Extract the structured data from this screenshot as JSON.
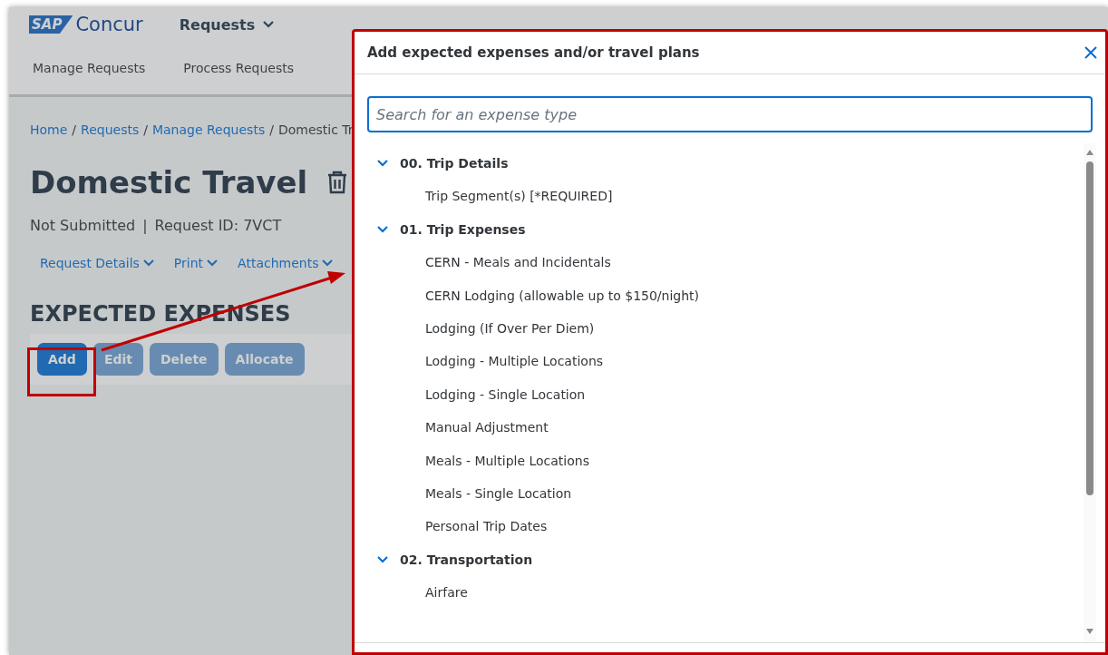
{
  "header": {
    "logo_badge": "SAP",
    "logo_text": "Concur",
    "menu": "Requests"
  },
  "subnav": [
    {
      "label": "Manage Requests"
    },
    {
      "label": "Process Requests"
    }
  ],
  "breadcrumb": [
    {
      "label": "Home",
      "link": true
    },
    {
      "label": "Requests",
      "link": true
    },
    {
      "label": "Manage Requests",
      "link": true
    },
    {
      "label": "Domestic Tr",
      "link": false
    }
  ],
  "breadcrumb_separator": "/",
  "status_separator": "|",
  "title": "Domestic Travel",
  "status": "Not Submitted",
  "request_id": "Request ID: 7VCT",
  "actions": [
    "Request Details",
    "Print",
    "Attachments"
  ],
  "section_title": "EXPECTED EXPENSES",
  "buttons": [
    {
      "label": "Add",
      "disabled": false
    },
    {
      "label": "Edit",
      "disabled": true
    },
    {
      "label": "Delete",
      "disabled": true
    },
    {
      "label": "Allocate",
      "disabled": true
    }
  ],
  "dialog": {
    "title": "Add expected expenses and/or travel plans",
    "search": {
      "placeholder": "Search for an expense type"
    },
    "groups": [
      {
        "label": "00. Trip Details",
        "expanded": true,
        "children": [
          "Trip Segment(s) [*REQUIRED]"
        ]
      },
      {
        "label": "01. Trip Expenses",
        "expanded": true,
        "children": [
          "CERN - Meals and Incidentals",
          "CERN Lodging (allowable up to $150/night)",
          "Lodging (If Over Per Diem)",
          "Lodging - Multiple Locations",
          "Lodging - Single Location",
          "Manual Adjustment",
          "Meals - Multiple Locations",
          "Meals - Single Location",
          "Personal Trip Dates"
        ]
      },
      {
        "label": "02. Transportation",
        "expanded": true,
        "children": [
          "Airfare"
        ]
      }
    ]
  }
}
